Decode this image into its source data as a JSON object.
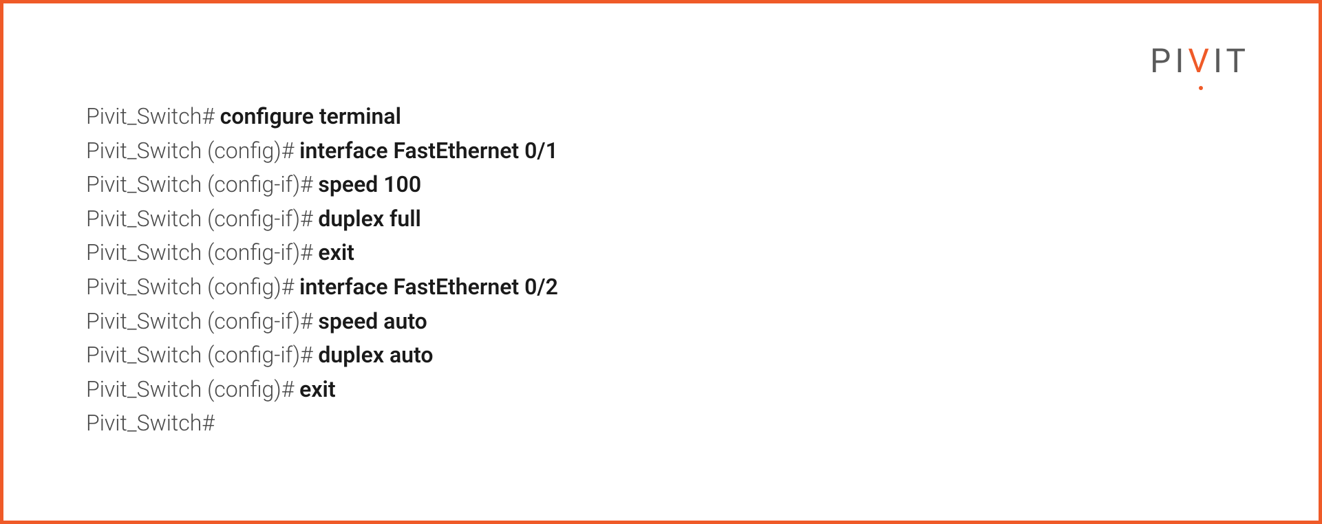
{
  "logo": {
    "p1": "PI",
    "v": "V",
    "p2": "IT"
  },
  "lines": [
    {
      "prompt": "Pivit_Switch# ",
      "cmd": "configure terminal"
    },
    {
      "prompt": "Pivit_Switch (config)# ",
      "cmd": "interface FastEthernet 0/1"
    },
    {
      "prompt": "Pivit_Switch (config-if)# ",
      "cmd": "speed 100"
    },
    {
      "prompt": "Pivit_Switch (config-if)# ",
      "cmd": "duplex full"
    },
    {
      "prompt": "Pivit_Switch (config-if)# ",
      "cmd": "exit"
    },
    {
      "prompt": "Pivit_Switch (config)# ",
      "cmd": "interface FastEthernet 0/2"
    },
    {
      "prompt": "Pivit_Switch (config-if)# ",
      "cmd": "speed auto"
    },
    {
      "prompt": "Pivit_Switch (config-if)# ",
      "cmd": "duplex auto"
    },
    {
      "prompt": "Pivit_Switch (config)# ",
      "cmd": "exit"
    },
    {
      "prompt": "Pivit_Switch#",
      "cmd": ""
    }
  ]
}
